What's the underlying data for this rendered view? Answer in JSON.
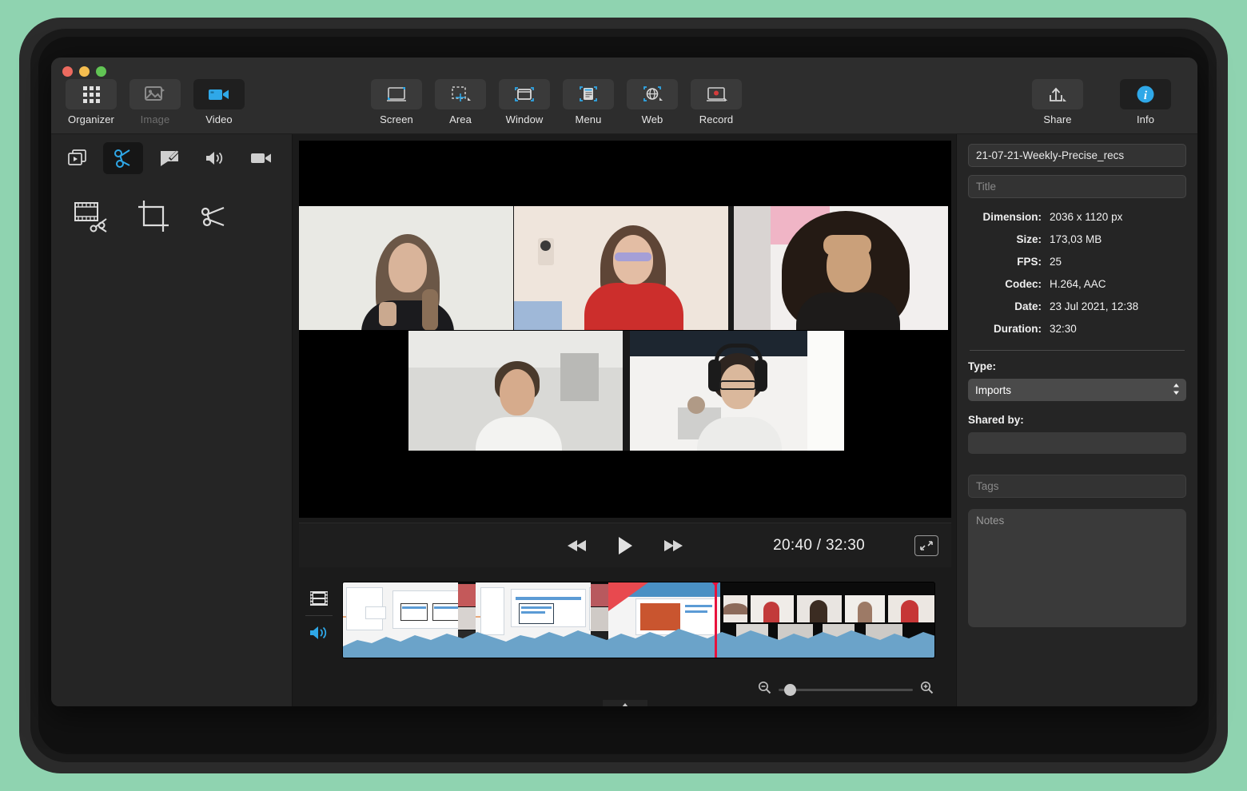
{
  "app": {
    "window_controls": [
      "close",
      "minimize",
      "zoom"
    ]
  },
  "toolbar": {
    "left_items": [
      {
        "label": "Organizer",
        "icon": "grid-icon",
        "state": "normal"
      },
      {
        "label": "Image",
        "icon": "image-icon",
        "state": "disabled"
      },
      {
        "label": "Video",
        "icon": "video-camera-icon",
        "state": "active"
      }
    ],
    "center_items": [
      {
        "label": "Screen",
        "icon": "screen-capture-icon"
      },
      {
        "label": "Area",
        "icon": "area-capture-icon"
      },
      {
        "label": "Window",
        "icon": "window-capture-icon"
      },
      {
        "label": "Menu",
        "icon": "menu-capture-icon"
      },
      {
        "label": "Web",
        "icon": "web-capture-icon"
      },
      {
        "label": "Record",
        "icon": "record-icon"
      }
    ],
    "right_items": [
      {
        "label": "Share",
        "icon": "share-upload-icon"
      },
      {
        "label": "Info",
        "icon": "info-circle-icon",
        "state": "active"
      }
    ]
  },
  "left_panel": {
    "mode_tools": [
      {
        "name": "frames-icon",
        "active": false
      },
      {
        "name": "scissors-icon",
        "active": true
      },
      {
        "name": "annotation-icon",
        "active": false
      },
      {
        "name": "speaker-icon",
        "active": false
      },
      {
        "name": "camera-icon",
        "active": false
      }
    ],
    "edit_tools": [
      {
        "name": "split-filmstrip-icon"
      },
      {
        "name": "crop-icon"
      },
      {
        "name": "trim-scissors-icon"
      }
    ]
  },
  "player": {
    "controls": [
      {
        "name": "rewind-button",
        "glyph": "◀◀"
      },
      {
        "name": "play-button",
        "glyph": "▶"
      },
      {
        "name": "fast-forward-button",
        "glyph": "▶▶"
      }
    ],
    "current_time": "20:40",
    "total_time": "32:30",
    "timecode": "20:40 / 32:30",
    "fullscreen_icon": "expand-arrows-icon"
  },
  "timeline": {
    "video_track_icon": "filmstrip-icon",
    "audio_track_icon": "speaker-wave-icon",
    "playhead_position_pct": 63,
    "zoom_out_icon": "zoom-out-icon",
    "zoom_in_icon": "zoom-in-icon",
    "zoom_value_pct": 4,
    "expander_icon": "triangle-up-icon"
  },
  "info_panel": {
    "filename": "21-07-21-Weekly-Precise_recs",
    "title_placeholder": "Title",
    "title_value": "",
    "metadata": [
      {
        "key": "Dimension:",
        "value": "2036 x 1120 px"
      },
      {
        "key": "Size:",
        "value": "173,03 MB"
      },
      {
        "key": "FPS:",
        "value": "25"
      },
      {
        "key": "Codec:",
        "value": "H.264, AAC"
      },
      {
        "key": "Date:",
        "value": "23 Jul 2021, 12:38"
      },
      {
        "key": "Duration:",
        "value": "32:30"
      }
    ],
    "type_label": "Type:",
    "type_value": "Imports",
    "shared_by_label": "Shared by:",
    "shared_by_value": "",
    "tags_placeholder": "Tags",
    "notes_placeholder": "Notes"
  },
  "colors": {
    "accent": "#2fa8e8",
    "playhead": "#e8123c",
    "desktop_background": "#8fd3b0",
    "panel": "#252525"
  }
}
